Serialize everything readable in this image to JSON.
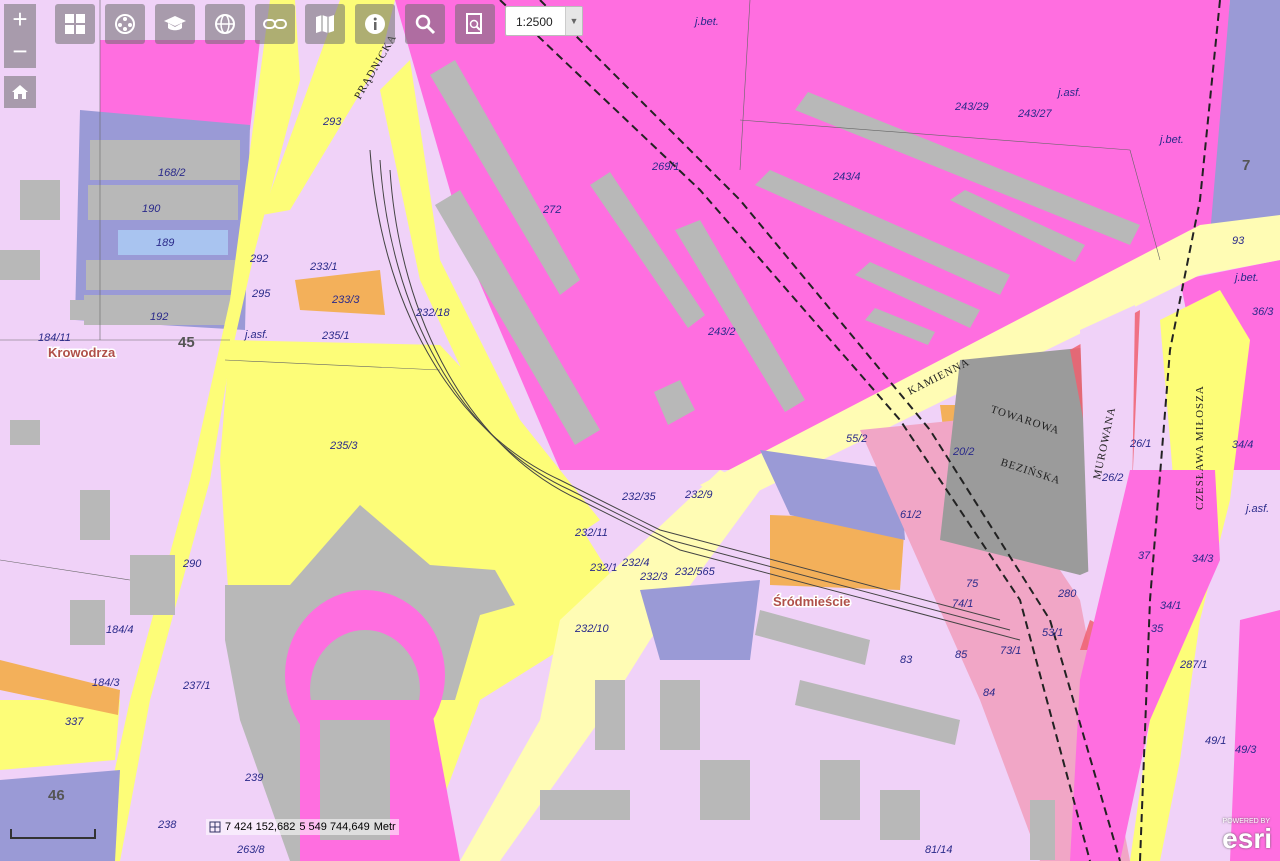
{
  "toolbar": {
    "buttons": [
      {
        "name": "basemap-gallery-button",
        "icon": "grid-icon"
      },
      {
        "name": "layers-button",
        "icon": "film-reel-icon"
      },
      {
        "name": "education-button",
        "icon": "graduation-cap-icon"
      },
      {
        "name": "globe-button",
        "icon": "globe-icon"
      },
      {
        "name": "link-button",
        "icon": "link-icon"
      },
      {
        "name": "map-book-button",
        "icon": "map-icon"
      },
      {
        "name": "info-button",
        "icon": "info-icon"
      },
      {
        "name": "search-button",
        "icon": "search-icon"
      },
      {
        "name": "print-button",
        "icon": "print-preview-icon"
      }
    ],
    "scale_value": "1:2500"
  },
  "zoom": {
    "in_label": "+",
    "out_label": "−"
  },
  "coordinates": {
    "x": "7 424 152,682",
    "y": "5 549 744,649",
    "unit": "Metr"
  },
  "attribution": {
    "logo": "esri",
    "powered": "POWERED BY"
  },
  "labels": {
    "districts": [
      "Krowodrza",
      "Śródmieście"
    ],
    "streets": [
      "PRĄDNICKA",
      "KAMIENNA",
      "TOWAROWA",
      "BEZIŃSKA",
      "MUROWANA",
      "CZESŁAWA MIŁOSZA"
    ],
    "district_numbers": [
      "45",
      "46",
      "7"
    ],
    "parcels": [
      "272",
      "269/1",
      "243/29",
      "243/27",
      "243/4",
      "243/2",
      "232/18",
      "235/3",
      "235/1",
      "233/3",
      "233/1",
      "293",
      "290",
      "292",
      "295",
      "184/11",
      "184/4",
      "184/3",
      "337",
      "239",
      "238",
      "237/1",
      "232/1",
      "232/4",
      "232/3",
      "232/10",
      "232/11",
      "232/35",
      "232/565",
      "232/9",
      "75",
      "74/1",
      "73/1",
      "53/1",
      "84",
      "85",
      "83",
      "61/2",
      "55/2",
      "20/2",
      "26/2",
      "26/1",
      "37",
      "35",
      "34/1",
      "34/3",
      "287/1",
      "49/1",
      "49/3",
      "93",
      "36/3",
      "34/4",
      "280",
      "168/2",
      "189",
      "192",
      "190",
      "263/8",
      "81/14"
    ],
    "land_types": [
      "j.bet.",
      "j.asf.",
      "j.asf.",
      "j.bet.",
      "j.asf.",
      "j.bet."
    ]
  },
  "colors": {
    "residential": "#f0d2f8",
    "industrial": "#ff6ee0",
    "road": "#fdfd78",
    "road_light": "#fffcb4",
    "building": "#b8b8b8",
    "public": "#9a9ad6",
    "commercial": "#f3b05a",
    "rail_corridor": "#f1a6c6",
    "red_strip": "#f06070"
  }
}
